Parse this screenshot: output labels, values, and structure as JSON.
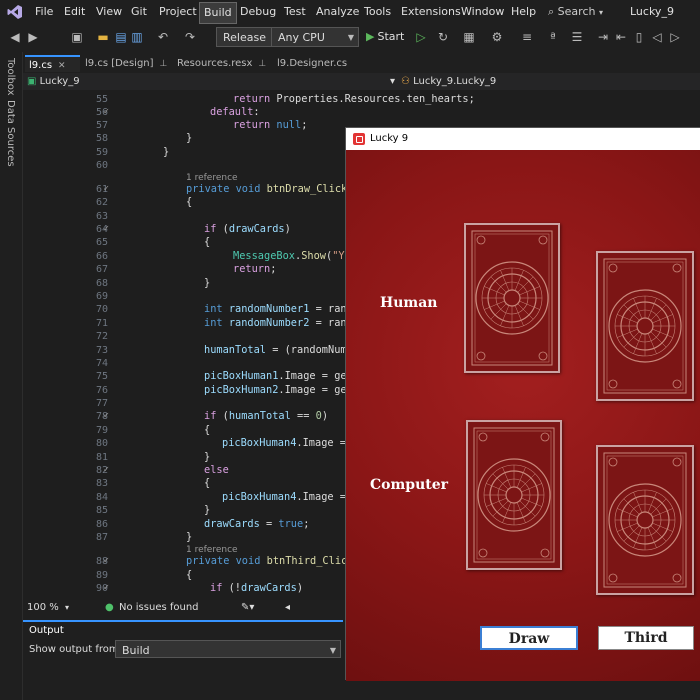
{
  "menubar": {
    "items": [
      "File",
      "Edit",
      "View",
      "Git",
      "Project",
      "Build",
      "Debug",
      "Test",
      "Analyze",
      "Tools",
      "Extensions",
      "Window",
      "Help"
    ],
    "active": "Build",
    "search_label": "Search",
    "solution_name": "Lucky_9"
  },
  "toolbar": {
    "configuration": "Release",
    "platform": "Any CPU",
    "start_label": "Start"
  },
  "side_tools": {
    "toolbox": "Toolbox",
    "data_sources": "Data Sources"
  },
  "tabs": [
    {
      "label": "l9.cs",
      "active": true
    },
    {
      "label": "l9.cs [Design]",
      "active": false
    },
    {
      "label": "Resources.resx",
      "active": false
    },
    {
      "label": "l9.Designer.cs",
      "active": false
    }
  ],
  "navbar": {
    "project": "Lucky_9",
    "class": "Lucky_9.Lucky_9"
  },
  "editor": {
    "lines": [
      {
        "n": "55",
        "text": "return Properties.Resources.ten_hearts;"
      },
      {
        "n": "56",
        "text": "default:"
      },
      {
        "n": "57",
        "text": "return null;"
      },
      {
        "n": "58",
        "text": "}"
      },
      {
        "n": "59",
        "text": "}"
      },
      {
        "n": "60",
        "text": ""
      },
      {
        "n": "61",
        "text": "private void btnDraw_Click("
      },
      {
        "n": "62",
        "text": "{"
      },
      {
        "n": "63",
        "text": ""
      },
      {
        "n": "64",
        "text": "if (drawCards)"
      },
      {
        "n": "65",
        "text": "{"
      },
      {
        "n": "66",
        "text": "MessageBox.Show(\"Yo"
      },
      {
        "n": "67",
        "text": "return;"
      },
      {
        "n": "68",
        "text": "}"
      },
      {
        "n": "69",
        "text": ""
      },
      {
        "n": "70",
        "text": "int randomNumber1 = rand"
      },
      {
        "n": "71",
        "text": "int randomNumber2 = rand"
      },
      {
        "n": "72",
        "text": ""
      },
      {
        "n": "73",
        "text": "humanTotal = (randomNumb"
      },
      {
        "n": "74",
        "text": ""
      },
      {
        "n": "75",
        "text": "picBoxHuman1.Image = get"
      },
      {
        "n": "76",
        "text": "picBoxHuman2.Image = get"
      },
      {
        "n": "77",
        "text": ""
      },
      {
        "n": "78",
        "text": "if (humanTotal == 0)"
      },
      {
        "n": "79",
        "text": "{"
      },
      {
        "n": "80",
        "text": "picBoxHuman4.Image ="
      },
      {
        "n": "81",
        "text": "}"
      },
      {
        "n": "82",
        "text": "else"
      },
      {
        "n": "83",
        "text": "{"
      },
      {
        "n": "84",
        "text": "picBoxHuman4.Image ="
      },
      {
        "n": "85",
        "text": "}"
      },
      {
        "n": "86",
        "text": "drawCards = true;"
      },
      {
        "n": "87",
        "text": "}"
      },
      {
        "n": "88",
        "text": "private void btnThird_Click"
      },
      {
        "n": "89",
        "text": "{"
      },
      {
        "n": "90",
        "text": "if (!drawCards)"
      }
    ],
    "reference_label": "1 reference"
  },
  "statusbar": {
    "zoom": "100 %",
    "issues": "No issues found"
  },
  "output": {
    "title": "Output",
    "show_from_label": "Show output from:",
    "show_from_value": "Build"
  },
  "form": {
    "title": "Lucky 9",
    "human_label": "Human",
    "computer_label": "Computer",
    "draw_label": "Draw",
    "third_label": "Third",
    "background_color": "#8e1818",
    "card_back_color": "#7c1515"
  }
}
